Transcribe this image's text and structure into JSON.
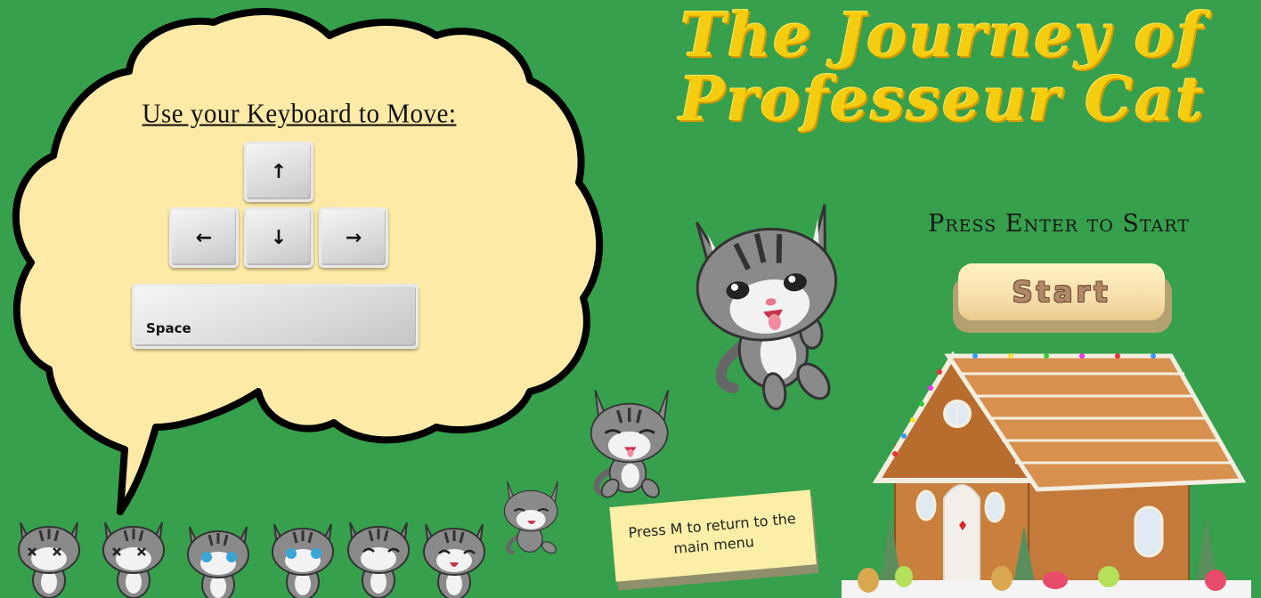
{
  "title": {
    "line1": "The Journey of",
    "line2": "Professeur Cat"
  },
  "controls": {
    "heading": "Use your Keyboard to Move:",
    "keys": {
      "up": "↑",
      "left": "←",
      "down": "↓",
      "right": "→",
      "space": "Space"
    }
  },
  "start": {
    "prompt": "Press Enter to Start",
    "button_label": "Start"
  },
  "menu_note": {
    "text": "Press M to return to the main menu"
  },
  "colors": {
    "background": "#36a04c",
    "bubble": "#fdeaa6",
    "title": "#f4cd10"
  }
}
